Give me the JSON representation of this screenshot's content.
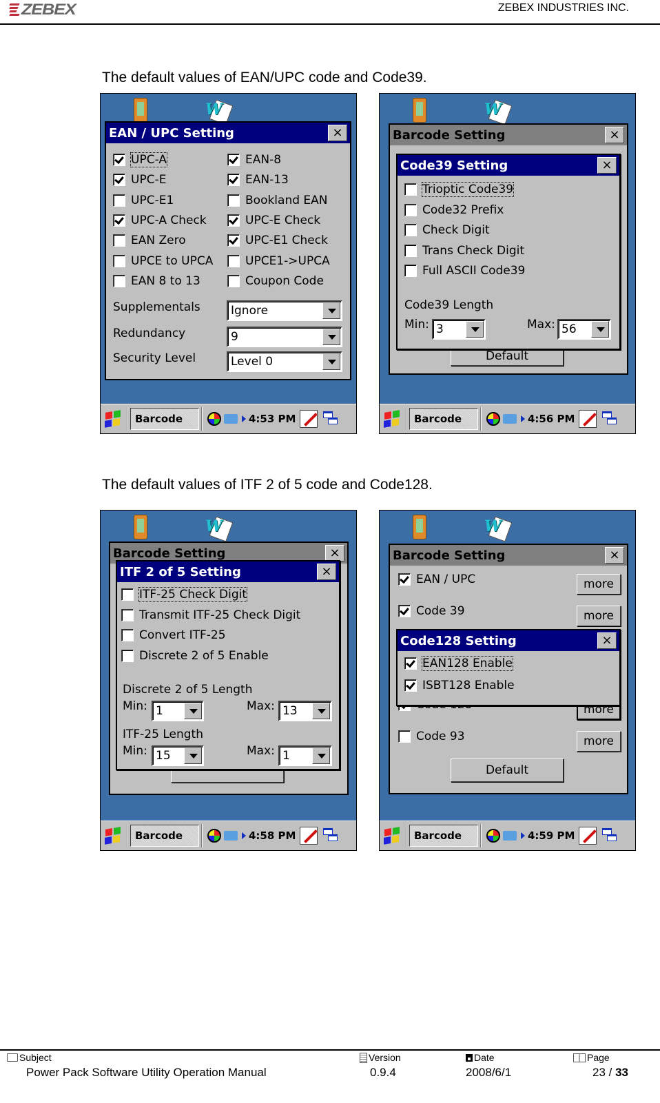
{
  "header": {
    "logo_text": "ZEBEX",
    "company": "ZEBEX INDUSTRIES INC."
  },
  "captions": [
    "The default values of EAN/UPC code and Code39.",
    "The default values of ITF 2 of 5 code and Code128."
  ],
  "shot1": {
    "dialog_title": "EAN / UPC Setting",
    "close": "×",
    "checkboxes": [
      {
        "label": "UPC-A",
        "checked": true
      },
      {
        "label": "EAN-8",
        "checked": true
      },
      {
        "label": "UPC-E",
        "checked": true
      },
      {
        "label": "EAN-13",
        "checked": true
      },
      {
        "label": "UPC-E1",
        "checked": false
      },
      {
        "label": "Bookland EAN",
        "checked": false
      },
      {
        "label": "UPC-A Check",
        "checked": true
      },
      {
        "label": "UPC-E Check",
        "checked": true
      },
      {
        "label": "EAN Zero",
        "checked": false
      },
      {
        "label": "UPC-E1 Check",
        "checked": true
      },
      {
        "label": "UPCE to UPCA",
        "checked": false
      },
      {
        "label": "UPCE1->UPCA",
        "checked": false
      },
      {
        "label": "EAN 8 to 13",
        "checked": false
      },
      {
        "label": "Coupon Code",
        "checked": false
      }
    ],
    "fields": [
      {
        "label": "Supplementals",
        "value": "Ignore"
      },
      {
        "label": "Redundancy",
        "value": "9"
      },
      {
        "label": "Security Level",
        "value": "Level 0"
      }
    ],
    "taskbar": {
      "app": "Barcode",
      "time": "4:53 PM"
    }
  },
  "shot2": {
    "parent_title": "Barcode Setting",
    "dialog_title": "Code39 Setting",
    "close": "×",
    "checkboxes": [
      {
        "label": "Trioptic Code39",
        "checked": false
      },
      {
        "label": "Code32 Prefix",
        "checked": false
      },
      {
        "label": "Check Digit",
        "checked": false
      },
      {
        "label": "Trans Check Digit",
        "checked": false
      },
      {
        "label": "Full ASCII Code39",
        "checked": false
      }
    ],
    "length_label": "Code39 Length",
    "min_label": "Min:",
    "min_value": "3",
    "max_label": "Max:",
    "max_value": "56",
    "default_button": "Default",
    "taskbar": {
      "app": "Barcode",
      "time": "4:56 PM"
    }
  },
  "shot3": {
    "parent_title": "Barcode Setting",
    "dialog_title": "ITF 2 of 5 Setting",
    "close": "×",
    "checkboxes": [
      {
        "label": "ITF-25 Check Digit",
        "checked": false
      },
      {
        "label": "Transmit ITF-25 Check Digit",
        "checked": false
      },
      {
        "label": "Convert ITF-25",
        "checked": false
      },
      {
        "label": "Discrete 2 of 5 Enable",
        "checked": false
      }
    ],
    "d25_length_label": "Discrete 2 of 5 Length",
    "d25_min": "1",
    "d25_max": "13",
    "itf_length_label": "ITF-25 Length",
    "itf_min": "15",
    "itf_max": "1",
    "min_label": "Min:",
    "max_label": "Max:",
    "taskbar": {
      "app": "Barcode",
      "time": "4:58 PM"
    }
  },
  "shot4": {
    "parent_title": "Barcode Setting",
    "close": "×",
    "parent_rows": [
      {
        "label": "EAN / UPC",
        "checked": true,
        "more": "more"
      },
      {
        "label": "Code 39",
        "checked": true,
        "more": "more"
      },
      {
        "label": "Code 128",
        "checked": true,
        "more": "more"
      },
      {
        "label": "Code 93",
        "checked": false,
        "more": "more"
      }
    ],
    "default_button": "Default",
    "dialog_title": "Code128 Setting",
    "checkboxes": [
      {
        "label": "EAN128 Enable",
        "checked": true
      },
      {
        "label": "ISBT128 Enable",
        "checked": true
      }
    ],
    "taskbar": {
      "app": "Barcode",
      "time": "4:59 PM"
    }
  },
  "footer": {
    "subject_label": "Subject",
    "subject": "Power Pack Software Utility Operation Manual",
    "version_label": "Version",
    "version": "0.9.4",
    "date_label": "Date",
    "date": "2008/6/1",
    "page_label": "Page",
    "page_current": "23",
    "page_sep": " / ",
    "page_total": "33"
  }
}
